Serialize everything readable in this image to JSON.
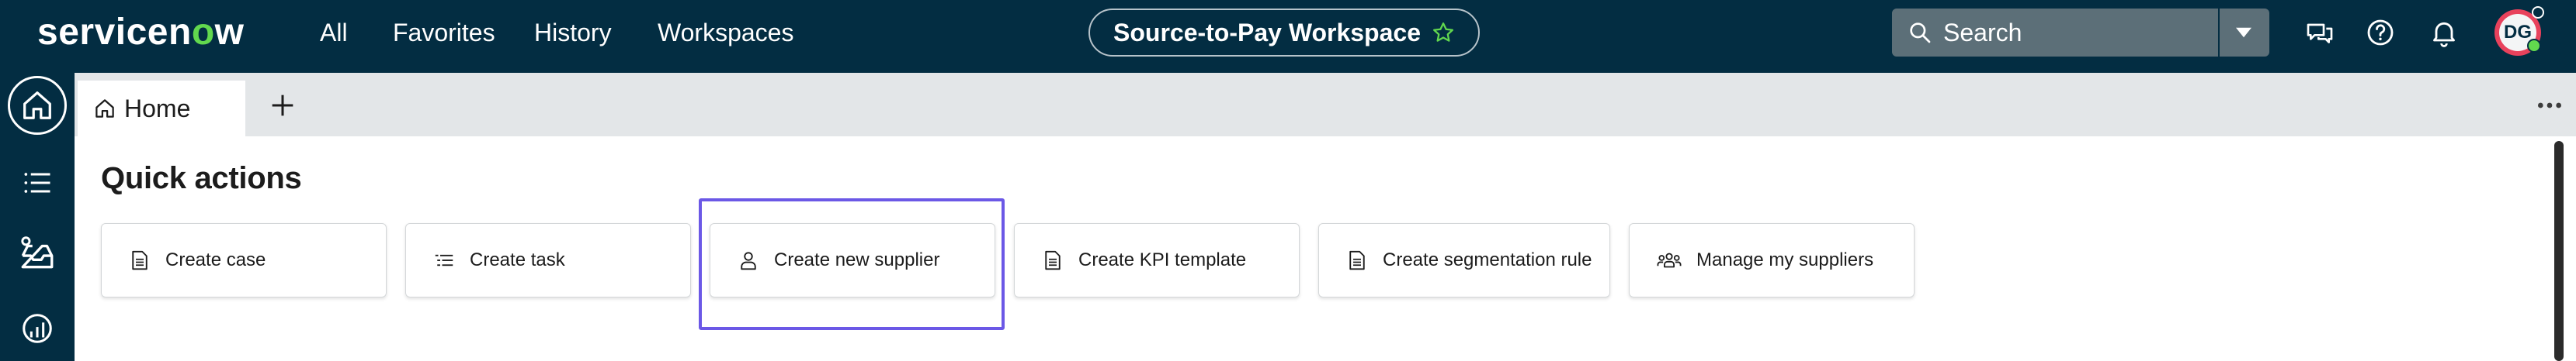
{
  "header": {
    "logo_text_before": "servicen",
    "logo_text_o": "o",
    "logo_text_after": "w",
    "nav": [
      "All",
      "Favorites",
      "History",
      "Workspaces"
    ],
    "workspace_title": "Source-to-Pay Workspace",
    "search": {
      "label": "Search"
    },
    "avatar_initials": "DG"
  },
  "tabs": {
    "home_label": "Home"
  },
  "main": {
    "section_title": "Quick actions",
    "quick_actions": [
      {
        "label": "Create case",
        "icon": "document-icon"
      },
      {
        "label": "Create task",
        "icon": "task-list-icon"
      },
      {
        "label": "Create new supplier",
        "icon": "person-icon"
      },
      {
        "label": "Create KPI template",
        "icon": "document-icon"
      },
      {
        "label": "Create segmentation rule",
        "icon": "document-icon"
      },
      {
        "label": "Manage my suppliers",
        "icon": "people-group-icon"
      }
    ]
  },
  "colors": {
    "header_bg": "#032d42",
    "logo_accent": "#62d84e",
    "highlight": "#6b58e6"
  }
}
